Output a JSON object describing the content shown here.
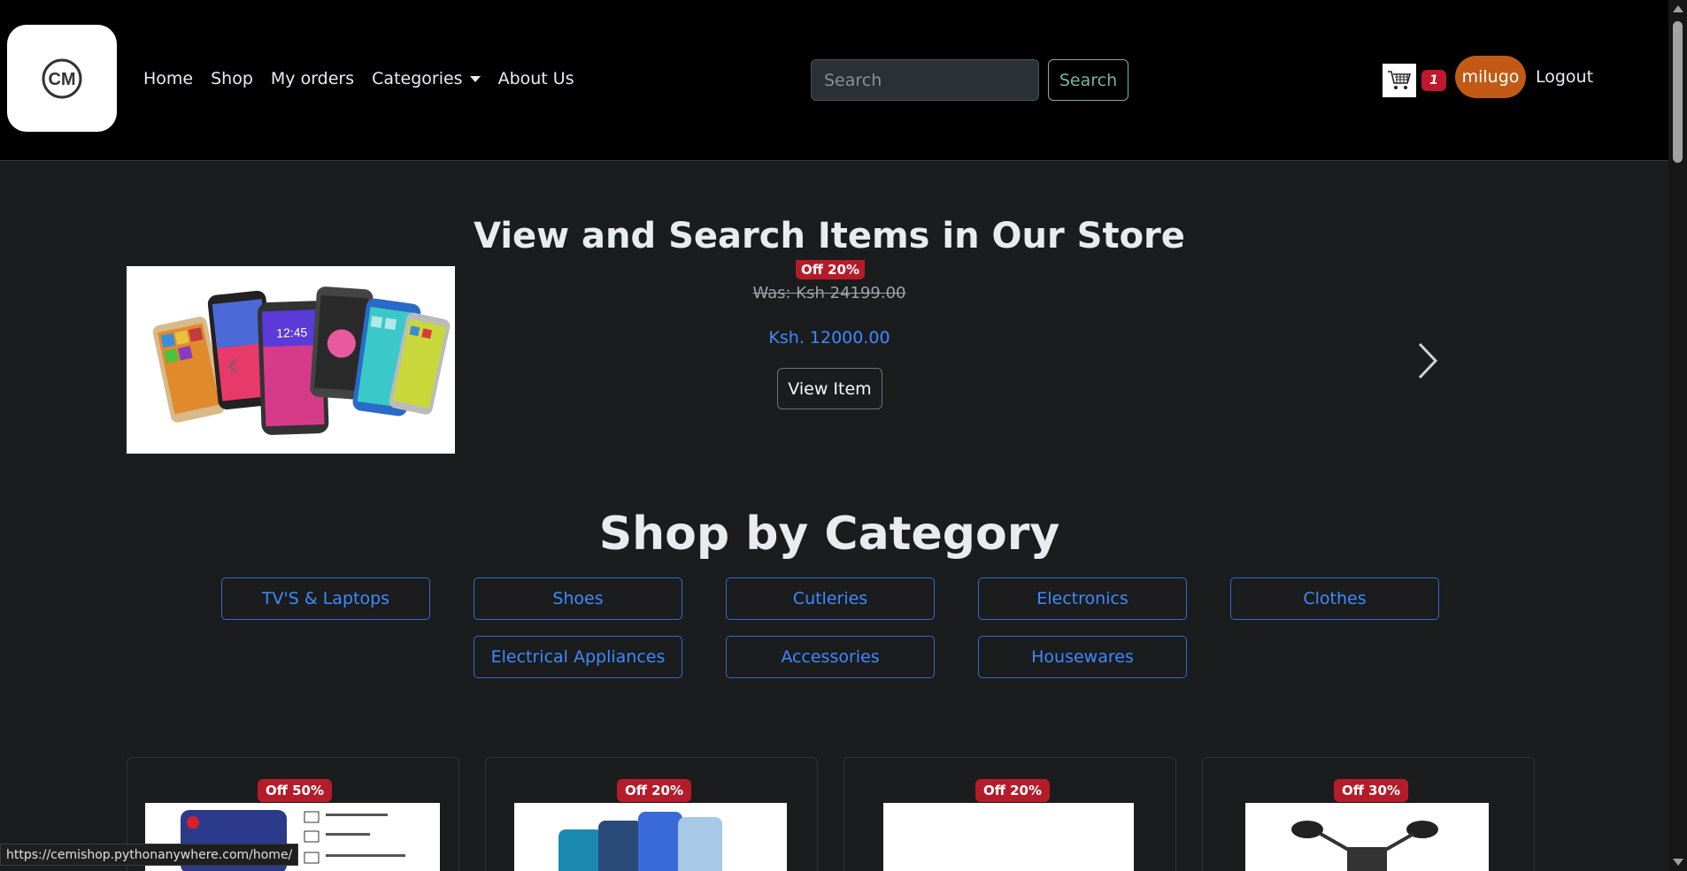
{
  "nav": {
    "logo_text": "CM",
    "links": [
      "Home",
      "Shop",
      "My orders",
      "Categories",
      "About Us"
    ],
    "search_placeholder": "Search",
    "search_button": "Search",
    "cart_count": "1",
    "user": "milugo",
    "logout": "Logout"
  },
  "hero": {
    "title": "View and Search Items in Our Store",
    "discount": "Off 20%",
    "was_price": "Was: Ksh 24199.00",
    "price": "Ksh. 12000.00",
    "view_button": "View Item"
  },
  "categories": {
    "title": "Shop by Category",
    "items": [
      "TV'S & Laptops",
      "Shoes",
      "Cutleries",
      "Electronics",
      "Clothes",
      "Electrical Appliances",
      "Accessories",
      "Housewares"
    ]
  },
  "products": [
    {
      "discount": "Off 50%"
    },
    {
      "discount": "Off 20%"
    },
    {
      "discount": "Off 20%"
    },
    {
      "discount": "Off 30%"
    }
  ],
  "status_url": "https://cemishop.pythonanywhere.com/home/",
  "colors": {
    "accent_blue": "#3d8bfd",
    "badge_red": "#b51c2a",
    "user_orange": "#c25a16",
    "search_green": "#75b798"
  }
}
